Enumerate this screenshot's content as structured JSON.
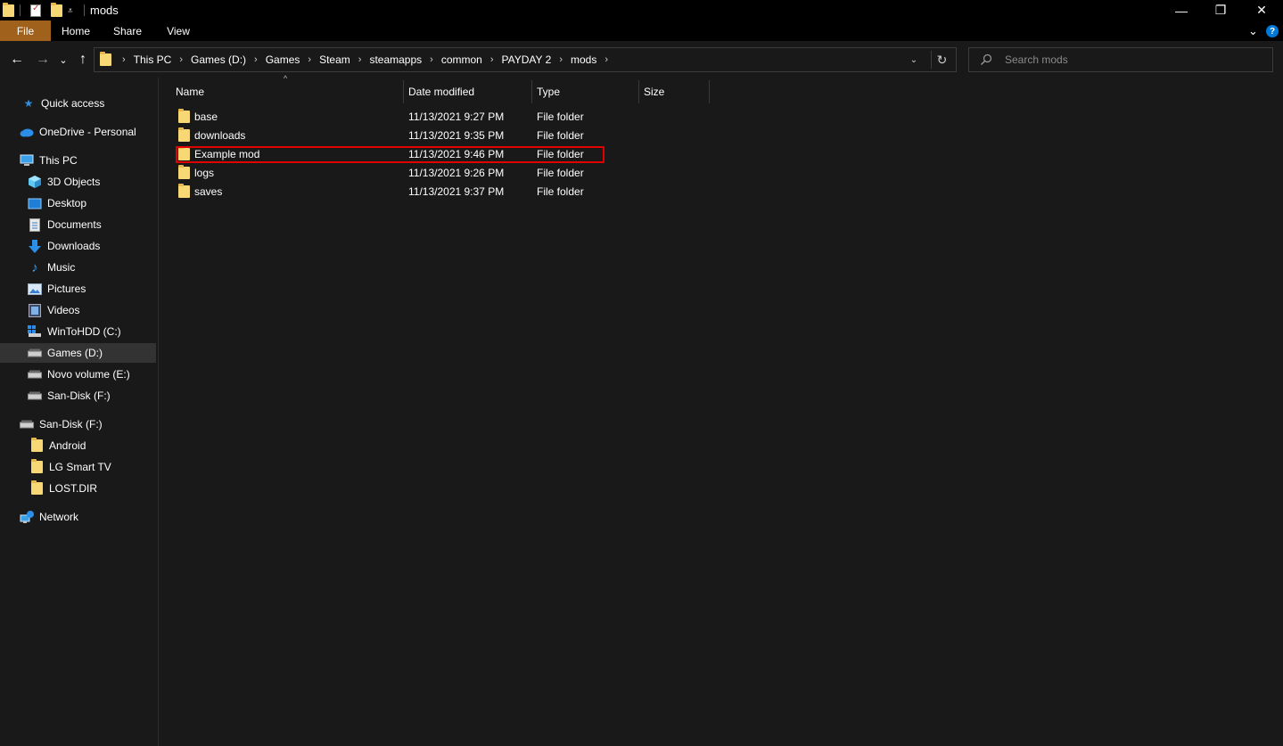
{
  "window": {
    "title": "mods",
    "minimize_glyph": "—",
    "maximize_glyph": "❐",
    "close_glyph": "✕"
  },
  "ribbon": {
    "tabs": [
      "File",
      "Home",
      "Share",
      "View"
    ],
    "collapse_glyph": "⌄",
    "help_glyph": "?"
  },
  "navigation": {
    "back_glyph": "←",
    "forward_glyph": "→",
    "recent_glyph": "⌄",
    "up_glyph": "↑"
  },
  "address": {
    "crumbs": [
      "This PC",
      "Games (D:)",
      "Games",
      "Steam",
      "steamapps",
      "common",
      "PAYDAY 2",
      "mods"
    ],
    "separator": "›",
    "dropdown_glyph": "⌄",
    "refresh_glyph": "↻"
  },
  "search": {
    "placeholder": "Search mods"
  },
  "sidebar": {
    "items": [
      {
        "label": "Quick access",
        "icon": "star-icon"
      },
      {
        "label": "OneDrive - Personal",
        "icon": "cloud-icon"
      },
      {
        "label": "This PC",
        "icon": "computer-icon"
      },
      {
        "label": "3D Objects",
        "icon": "cube-icon"
      },
      {
        "label": "Desktop",
        "icon": "desktop-icon"
      },
      {
        "label": "Documents",
        "icon": "document-icon"
      },
      {
        "label": "Downloads",
        "icon": "download-arrow-icon"
      },
      {
        "label": "Music",
        "icon": "music-note-icon"
      },
      {
        "label": "Pictures",
        "icon": "picture-icon"
      },
      {
        "label": "Videos",
        "icon": "film-icon"
      },
      {
        "label": "WinToHDD (C:)",
        "icon": "windows-drive-icon"
      },
      {
        "label": "Games (D:)",
        "icon": "drive-icon",
        "selected": true
      },
      {
        "label": "Novo volume (E:)",
        "icon": "drive-icon"
      },
      {
        "label": "San-Disk (F:)",
        "icon": "drive-icon"
      },
      {
        "label": "San-Disk (F:)",
        "icon": "usb-drive-icon"
      },
      {
        "label": "Android",
        "icon": "folder-icon"
      },
      {
        "label": "LG Smart TV",
        "icon": "folder-icon"
      },
      {
        "label": "LOST.DIR",
        "icon": "folder-icon"
      },
      {
        "label": "Network",
        "icon": "network-icon"
      }
    ]
  },
  "file_list": {
    "columns": [
      "Name",
      "Date modified",
      "Type",
      "Size"
    ],
    "sort_glyph": "^",
    "rows": [
      {
        "name": "base",
        "date": "11/13/2021 9:27 PM",
        "type": "File folder",
        "size": ""
      },
      {
        "name": "downloads",
        "date": "11/13/2021 9:35 PM",
        "type": "File folder",
        "size": ""
      },
      {
        "name": "Example mod",
        "date": "11/13/2021 9:46 PM",
        "type": "File folder",
        "size": "",
        "highlighted": true
      },
      {
        "name": "logs",
        "date": "11/13/2021 9:26 PM",
        "type": "File folder",
        "size": ""
      },
      {
        "name": "saves",
        "date": "11/13/2021 9:37 PM",
        "type": "File folder",
        "size": ""
      }
    ]
  },
  "colors": {
    "background": "#191919",
    "file_tab": "#a0611d",
    "folder": "#f8d775",
    "highlight_outline": "#e00000",
    "accent": "#0078d7"
  }
}
